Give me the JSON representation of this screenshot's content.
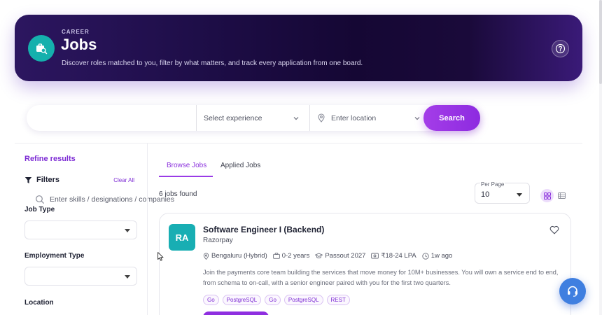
{
  "hero": {
    "eyebrow": "CAREER",
    "title": "Jobs",
    "subtitle": "Discover roles matched to you, filter by what matters, and track every application from one board.",
    "icon": "briefcase-search-icon",
    "help_icon": "help-circle-icon"
  },
  "search": {
    "skills_placeholder": "Enter skills / designations / companies",
    "experience_placeholder": "Select experience",
    "location_placeholder": "Enter location",
    "button_label": "Search"
  },
  "sidebar": {
    "heading": "Refine results",
    "filters_label": "Filters",
    "clear_all": "Clear All",
    "sections": [
      {
        "label": "Job Type",
        "value": ""
      },
      {
        "label": "Employment Type",
        "value": ""
      },
      {
        "label": "Location",
        "value": ""
      }
    ]
  },
  "tabs": [
    {
      "label": "Browse Jobs",
      "active": true
    },
    {
      "label": "Applied Jobs",
      "active": false
    }
  ],
  "results": {
    "count_text": "6 jobs found",
    "per_page_label": "Per Page",
    "per_page_value": "10",
    "view_modes": [
      "grid-view-icon",
      "list-view-icon"
    ]
  },
  "jobs": [
    {
      "logo_text": "RA",
      "title": "Software Engineer I (Backend)",
      "company": "Razorpay",
      "location": "Bengaluru (Hybrid)",
      "experience": "0-2 years",
      "passout": "Passout 2027",
      "salary": "₹18-24 LPA",
      "posted": "1w ago",
      "description": "Join the payments core team building the services that move money for 10M+ businesses. You will own a service end to end, from schema to on-call, with a senior engineer paired with you for the first two quarters.",
      "skills": [
        "Go",
        "PostgreSQL",
        "Go",
        "PostgreSQL",
        "REST"
      ]
    }
  ],
  "colors": {
    "accent": "#8f2fe0",
    "hero_bg": "#1d0d46",
    "logo_teal": "#18aeb3",
    "support_blue": "#3f7fe0"
  }
}
